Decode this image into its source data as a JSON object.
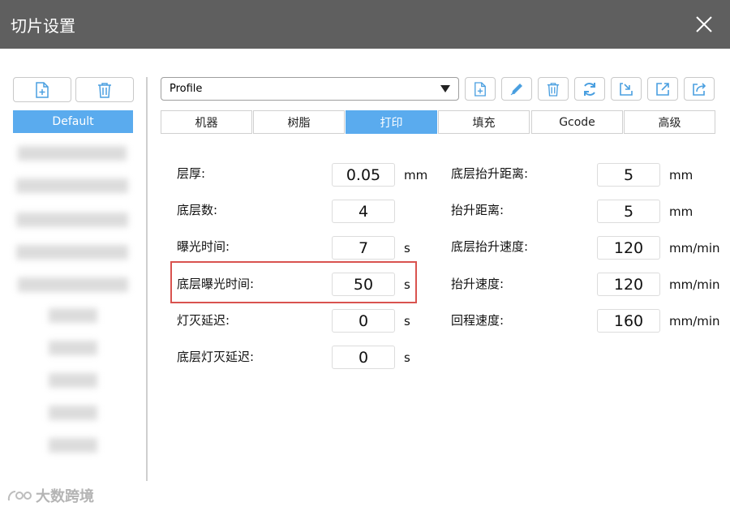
{
  "window": {
    "title": "切片设置"
  },
  "left_panel": {
    "default_item": "Default"
  },
  "toolbar": {
    "profile_value": "Profile"
  },
  "tabs": [
    "机器",
    "树脂",
    "打印",
    "填充",
    "Gcode",
    "高级"
  ],
  "active_tab": "打印",
  "form": {
    "left": [
      {
        "label": "层厚:",
        "value": "0.05",
        "unit": "mm"
      },
      {
        "label": "底层数:",
        "value": "4",
        "unit": ""
      },
      {
        "label": "曝光时间:",
        "value": "7",
        "unit": "s"
      },
      {
        "label": "底层曝光时间:",
        "value": "50",
        "unit": "s"
      },
      {
        "label": "灯灭延迟:",
        "value": "0",
        "unit": "s"
      },
      {
        "label": "底层灯灭延迟:",
        "value": "0",
        "unit": "s"
      }
    ],
    "right": [
      {
        "label": "底层抬升距离:",
        "value": "5",
        "unit": "mm"
      },
      {
        "label": "抬升距离:",
        "value": "5",
        "unit": "mm"
      },
      {
        "label": "底层抬升速度:",
        "value": "120",
        "unit": "mm/min"
      },
      {
        "label": "抬升速度:",
        "value": "120",
        "unit": "mm/min"
      },
      {
        "label": "回程速度:",
        "value": "160",
        "unit": "mm/min"
      }
    ]
  },
  "watermark": {
    "text": "大数跨境"
  },
  "colors": {
    "accent": "#5aabee",
    "titlebar": "#5f5f5f",
    "highlight": "#d9534f"
  }
}
